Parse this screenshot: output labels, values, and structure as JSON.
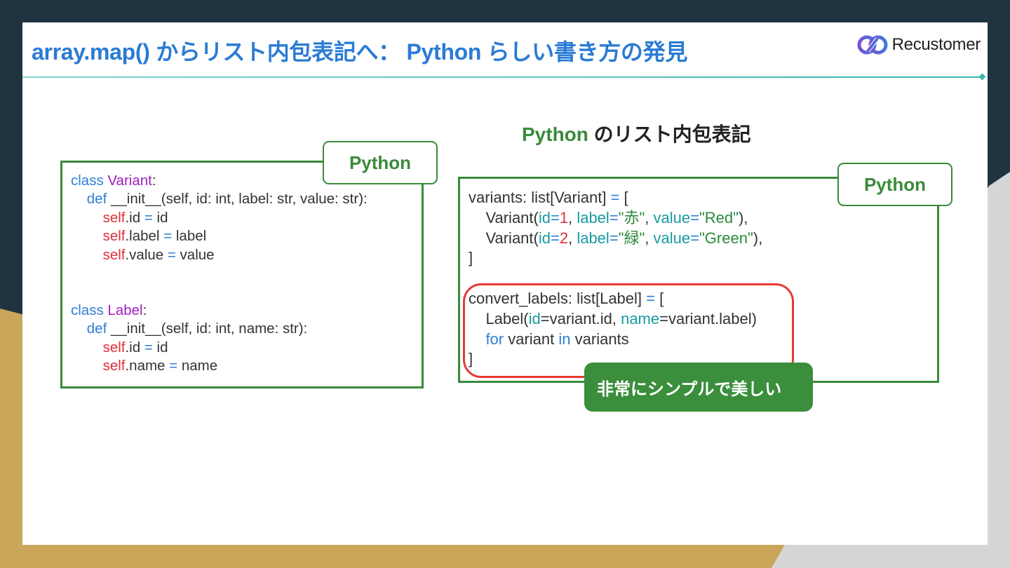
{
  "slide": {
    "title": "array.map() からリスト内包表記へ： Python らしい書き方の発見",
    "logo_text": "Recustomer",
    "section_title_accent": "Python",
    "section_title_rest": " のリスト内包表記",
    "callout": "非常にシンプルで美しい"
  },
  "left_panel": {
    "tag": "Python",
    "lines": [
      [
        {
          "t": "class ",
          "c": "kw"
        },
        {
          "t": "Variant",
          "c": "cls"
        },
        {
          "t": ":",
          "c": ""
        }
      ],
      [
        {
          "t": "    def ",
          "c": "kw"
        },
        {
          "t": "__init__(self, id: int, label: str, value: str):",
          "c": ""
        }
      ],
      [
        {
          "t": "        self",
          "c": "self"
        },
        {
          "t": ".id ",
          "c": ""
        },
        {
          "t": "=",
          "c": "op"
        },
        {
          "t": " id",
          "c": ""
        }
      ],
      [
        {
          "t": "        self",
          "c": "self"
        },
        {
          "t": ".label ",
          "c": ""
        },
        {
          "t": "=",
          "c": "op"
        },
        {
          "t": " label",
          "c": ""
        }
      ],
      [
        {
          "t": "        self",
          "c": "self"
        },
        {
          "t": ".value ",
          "c": ""
        },
        {
          "t": "=",
          "c": "op"
        },
        {
          "t": " value",
          "c": ""
        }
      ],
      [
        {
          "t": " ",
          "c": ""
        }
      ],
      [
        {
          "t": " ",
          "c": ""
        }
      ],
      [
        {
          "t": "class ",
          "c": "kw"
        },
        {
          "t": "Label",
          "c": "cls"
        },
        {
          "t": ":",
          "c": ""
        }
      ],
      [
        {
          "t": "    def ",
          "c": "kw"
        },
        {
          "t": "__init__(self, id: int, name: str):",
          "c": ""
        }
      ],
      [
        {
          "t": "        self",
          "c": "self"
        },
        {
          "t": ".id ",
          "c": ""
        },
        {
          "t": "=",
          "c": "op"
        },
        {
          "t": " id",
          "c": ""
        }
      ],
      [
        {
          "t": "        self",
          "c": "self"
        },
        {
          "t": ".name ",
          "c": ""
        },
        {
          "t": "=",
          "c": "op"
        },
        {
          "t": " name",
          "c": ""
        }
      ]
    ]
  },
  "right_panel": {
    "tag": "Python",
    "lines": [
      [
        {
          "t": "variants: list[Variant] ",
          "c": ""
        },
        {
          "t": "=",
          "c": "op"
        },
        {
          "t": " [",
          "c": ""
        }
      ],
      [
        {
          "t": "    Variant(",
          "c": ""
        },
        {
          "t": "id",
          "c": "attr"
        },
        {
          "t": "=",
          "c": "op"
        },
        {
          "t": "1",
          "c": "num"
        },
        {
          "t": ", ",
          "c": ""
        },
        {
          "t": "label",
          "c": "attr"
        },
        {
          "t": "=",
          "c": "op"
        },
        {
          "t": "\"赤\"",
          "c": "str"
        },
        {
          "t": ", ",
          "c": ""
        },
        {
          "t": "value",
          "c": "attr"
        },
        {
          "t": "=",
          "c": "op"
        },
        {
          "t": "\"Red\"",
          "c": "str"
        },
        {
          "t": "),",
          "c": ""
        }
      ],
      [
        {
          "t": "    Variant(",
          "c": ""
        },
        {
          "t": "id",
          "c": "attr"
        },
        {
          "t": "=",
          "c": "op"
        },
        {
          "t": "2",
          "c": "num"
        },
        {
          "t": ", ",
          "c": ""
        },
        {
          "t": "label",
          "c": "attr"
        },
        {
          "t": "=",
          "c": "op"
        },
        {
          "t": "\"緑\"",
          "c": "str"
        },
        {
          "t": ", ",
          "c": ""
        },
        {
          "t": "value",
          "c": "attr"
        },
        {
          "t": "=",
          "c": "op"
        },
        {
          "t": "\"Green\"",
          "c": "str"
        },
        {
          "t": "),",
          "c": ""
        }
      ],
      [
        {
          "t": "]",
          "c": ""
        }
      ],
      [
        {
          "t": " ",
          "c": ""
        }
      ],
      [
        {
          "t": "convert_labels: list[Label] ",
          "c": ""
        },
        {
          "t": "=",
          "c": "op"
        },
        {
          "t": " [",
          "c": ""
        }
      ],
      [
        {
          "t": "    Label(",
          "c": ""
        },
        {
          "t": "id",
          "c": "attr"
        },
        {
          "t": "=variant.id, ",
          "c": ""
        },
        {
          "t": "name",
          "c": "attr"
        },
        {
          "t": "=variant.label)",
          "c": ""
        }
      ],
      [
        {
          "t": "    for",
          "c": "kw"
        },
        {
          "t": " variant ",
          "c": ""
        },
        {
          "t": "in",
          "c": "kw"
        },
        {
          "t": " variants",
          "c": ""
        }
      ],
      [
        {
          "t": "]",
          "c": ""
        }
      ]
    ]
  },
  "colors": {
    "title_blue": "#2a7bd4",
    "frame_green": "#3a8a3a",
    "callout_green": "#3a8e3c",
    "highlight_red": "#e53935",
    "background_navy": "#1f3340",
    "background_gold": "#c9a65a"
  },
  "icons": {
    "logo": "recustomer-logo-icon"
  }
}
